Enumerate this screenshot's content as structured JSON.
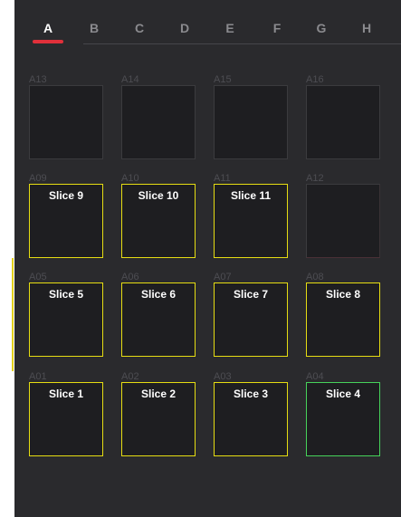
{
  "tabs": [
    {
      "label": "A",
      "active": true
    },
    {
      "label": "B",
      "active": false
    },
    {
      "label": "C",
      "active": false
    },
    {
      "label": "D",
      "active": false
    },
    {
      "label": "E",
      "active": false
    },
    {
      "label": "F",
      "active": false
    },
    {
      "label": "G",
      "active": false
    },
    {
      "label": "H",
      "active": false
    }
  ],
  "pads": [
    {
      "id": "A13",
      "label": "",
      "state": "empty"
    },
    {
      "id": "A14",
      "label": "",
      "state": "empty"
    },
    {
      "id": "A15",
      "label": "",
      "state": "empty"
    },
    {
      "id": "A16",
      "label": "",
      "state": "empty"
    },
    {
      "id": "A09",
      "label": "Slice 9",
      "state": "assigned"
    },
    {
      "id": "A10",
      "label": "Slice 10",
      "state": "assigned"
    },
    {
      "id": "A11",
      "label": "Slice 11",
      "state": "assigned"
    },
    {
      "id": "A12",
      "label": "",
      "state": "empty-reddish"
    },
    {
      "id": "A05",
      "label": "Slice 5",
      "state": "assigned"
    },
    {
      "id": "A06",
      "label": "Slice 6",
      "state": "assigned"
    },
    {
      "id": "A07",
      "label": "Slice 7",
      "state": "assigned"
    },
    {
      "id": "A08",
      "label": "Slice 8",
      "state": "assigned"
    },
    {
      "id": "A01",
      "label": "Slice 1",
      "state": "assigned"
    },
    {
      "id": "A02",
      "label": "Slice 2",
      "state": "assigned"
    },
    {
      "id": "A03",
      "label": "Slice 3",
      "state": "assigned"
    },
    {
      "id": "A04",
      "label": "Slice 4",
      "state": "selected"
    }
  ],
  "colors": {
    "panel_bg": "#2a2a2d",
    "pad_bg": "#1e1e21",
    "assigned_border": "#e6dd12",
    "selected_border": "#46d25a",
    "active_tab_underline": "#e0303a"
  }
}
